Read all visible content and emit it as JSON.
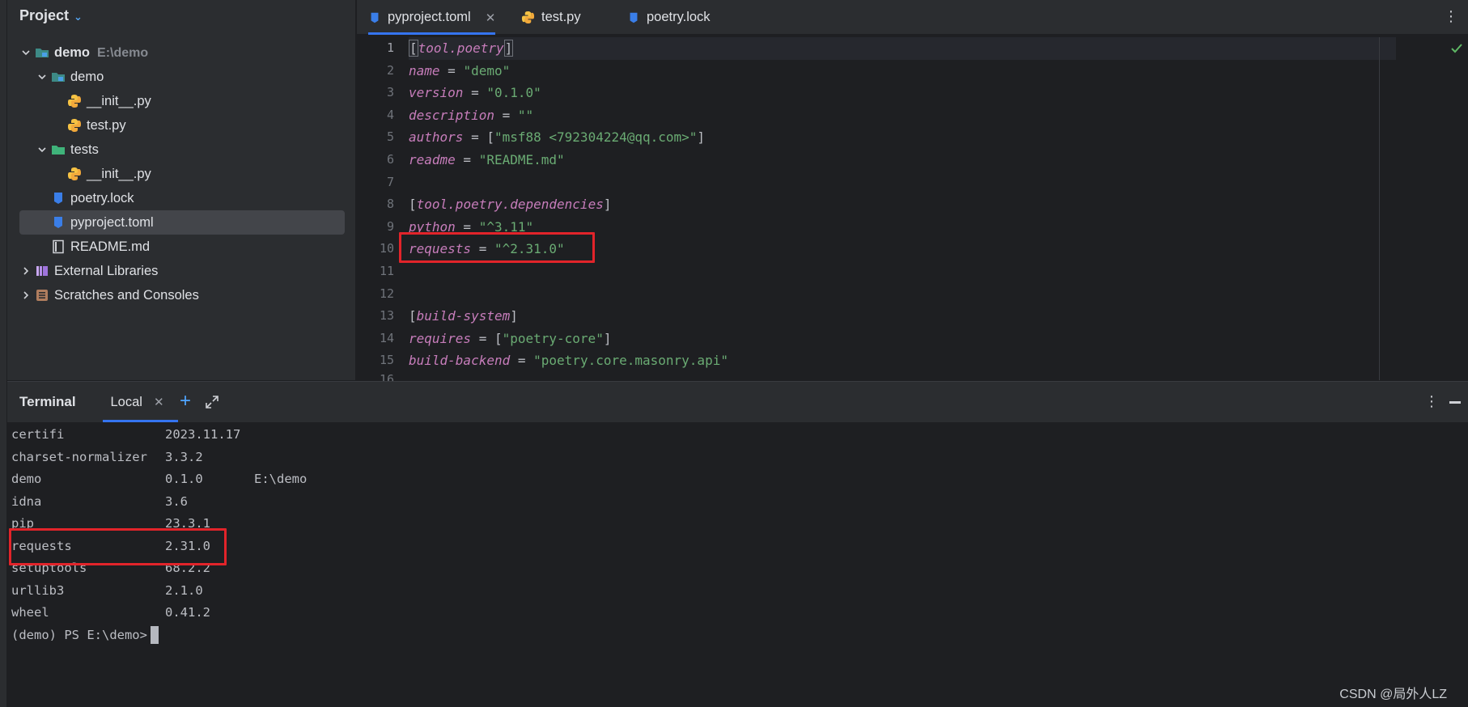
{
  "project_panel": {
    "title": "Project",
    "tree": [
      {
        "label": "demo",
        "path": "E:\\demo",
        "type": "module-folder",
        "level": 0,
        "expanded": true,
        "bold": true
      },
      {
        "label": "demo",
        "type": "module-folder",
        "level": 1,
        "expanded": true
      },
      {
        "label": "__init__.py",
        "type": "python-file",
        "level": 2
      },
      {
        "label": "test.py",
        "type": "python-file",
        "level": 2
      },
      {
        "label": "tests",
        "type": "test-folder",
        "level": 1,
        "expanded": true
      },
      {
        "label": "__init__.py",
        "type": "python-file",
        "level": 2
      },
      {
        "label": "poetry.lock",
        "type": "lock-file",
        "level": 1
      },
      {
        "label": "pyproject.toml",
        "type": "toml-file",
        "level": 1,
        "selected": true
      },
      {
        "label": "README.md",
        "type": "markdown-file",
        "level": 1
      },
      {
        "label": "External Libraries",
        "type": "libraries",
        "level": 0,
        "expanded": false
      },
      {
        "label": "Scratches and Consoles",
        "type": "scratches",
        "level": 0,
        "expanded": false
      }
    ]
  },
  "editor": {
    "tabs": [
      {
        "label": "pyproject.toml",
        "icon": "toml-file-icon",
        "active": true,
        "closable": true
      },
      {
        "label": "test.py",
        "icon": "python-file-icon",
        "active": false
      },
      {
        "label": "poetry.lock",
        "icon": "lock-file-icon",
        "active": false
      }
    ],
    "line_numbers": [
      "1",
      "2",
      "3",
      "4",
      "5",
      "6",
      "7",
      "8",
      "9",
      "10",
      "11",
      "12",
      "13",
      "14",
      "15",
      "16"
    ],
    "lines": {
      "l1": {
        "open": "[",
        "section": "tool.poetry",
        "close": "]"
      },
      "l2": {
        "key": "name",
        "eq": " = ",
        "val": "\"demo\""
      },
      "l3": {
        "key": "version",
        "eq": " = ",
        "val": "\"0.1.0\""
      },
      "l4": {
        "key": "description",
        "eq": " = ",
        "val": "\"\""
      },
      "l5": {
        "key": "authors",
        "eq": " = [",
        "val": "\"msf88 <792304224@qq.com>\"",
        "end": "]"
      },
      "l6": {
        "key": "readme",
        "eq": " = ",
        "val": "\"README.md\""
      },
      "l8": {
        "open": "[",
        "section": "tool.poetry.dependencies",
        "close": "]"
      },
      "l9": {
        "key": "python",
        "eq": " = ",
        "val": "\"^3.11\""
      },
      "l10": {
        "key": "requests",
        "eq": " = ",
        "val": "\"^2.31.0\""
      },
      "l13": {
        "open": "[",
        "section": "build-system",
        "close": "]"
      },
      "l14": {
        "key": "requires",
        "eq": " = [",
        "val": "\"poetry-core\"",
        "end": "]"
      },
      "l15": {
        "key": "build-backend",
        "eq": " = ",
        "val": "\"poetry.core.masonry.api\""
      }
    }
  },
  "terminal": {
    "title": "Terminal",
    "tab_label": "Local",
    "packages": [
      {
        "name": "certifi",
        "version": "2023.11.17",
        "location": ""
      },
      {
        "name": "charset-normalizer",
        "version": "3.3.2",
        "location": ""
      },
      {
        "name": "demo",
        "version": "0.1.0",
        "location": "E:\\demo"
      },
      {
        "name": "idna",
        "version": "3.6",
        "location": ""
      },
      {
        "name": "pip",
        "version": "23.3.1",
        "location": ""
      },
      {
        "name": "requests",
        "version": "2.31.0",
        "location": ""
      },
      {
        "name": "setuptools",
        "version": "68.2.2",
        "location": ""
      },
      {
        "name": "urllib3",
        "version": "2.1.0",
        "location": ""
      },
      {
        "name": "wheel",
        "version": "0.41.2",
        "location": ""
      }
    ],
    "prompt": "(demo) PS E:\\demo>"
  },
  "watermark": "CSDN @局外人LZ",
  "colors": {
    "accent": "#3574f0",
    "highlight_box": "#e2242a",
    "keyword": "#c77dbb",
    "string": "#6aab73"
  }
}
